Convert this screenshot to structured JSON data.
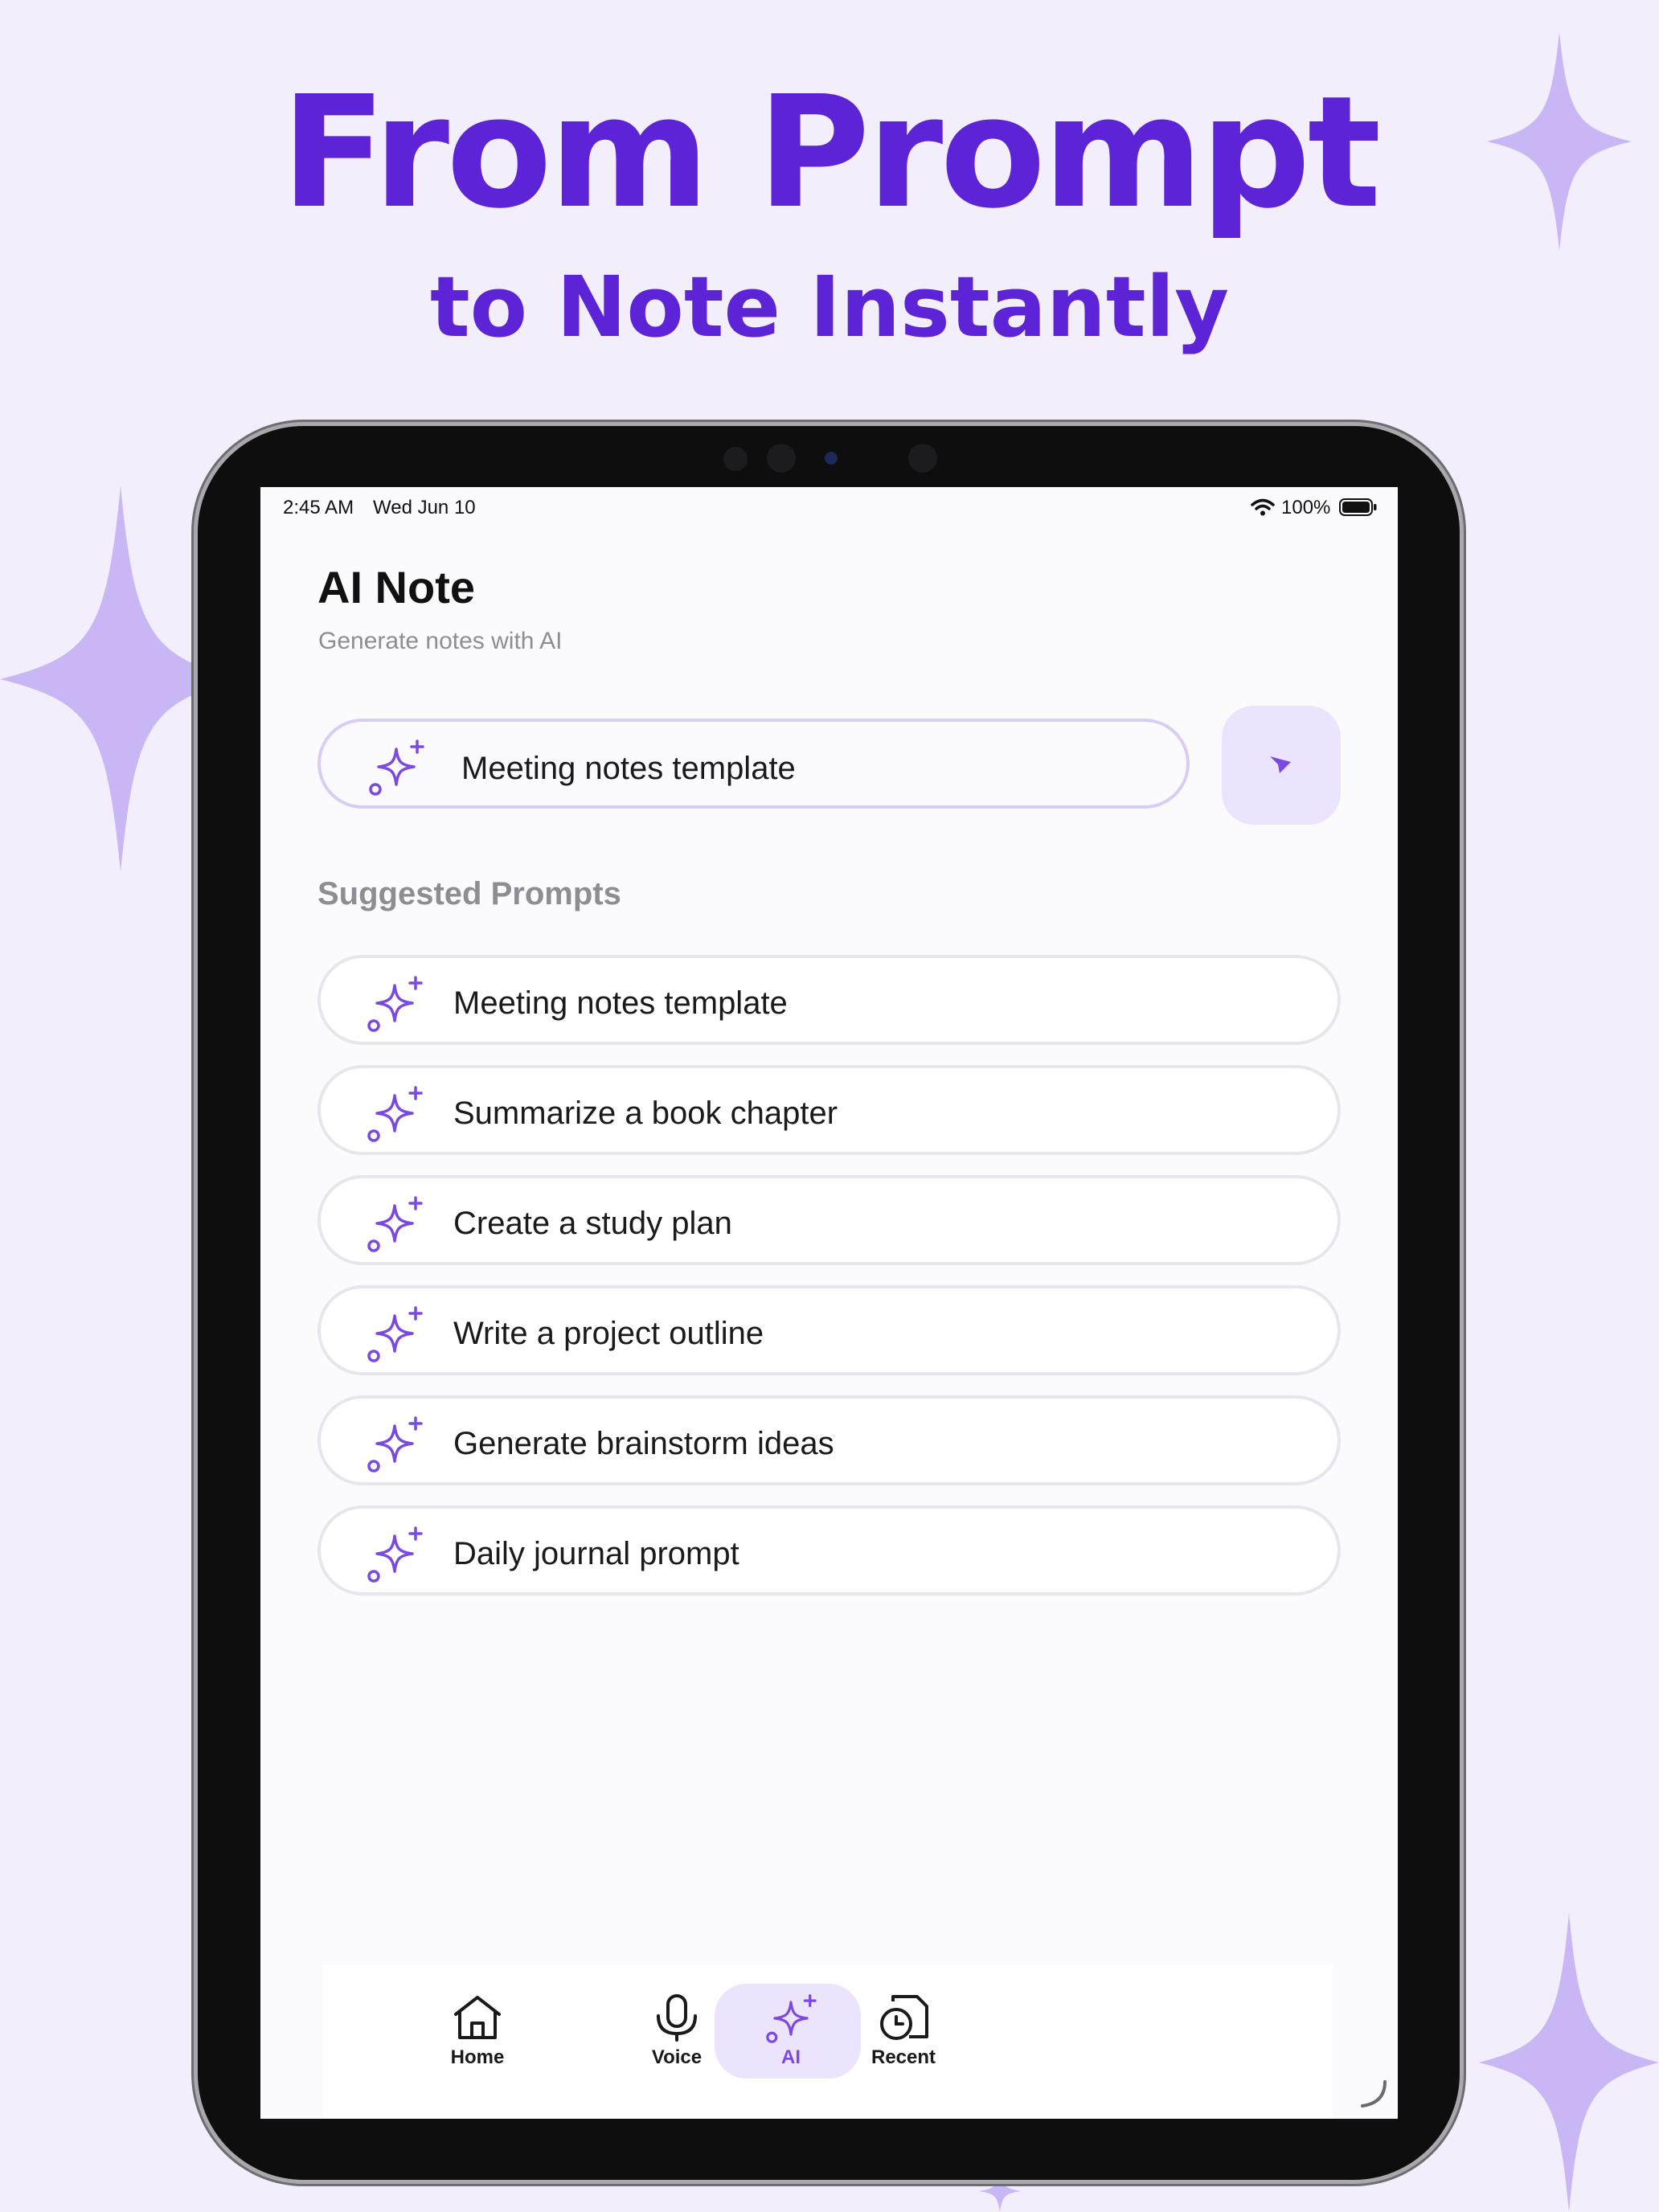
{
  "hero": {
    "title": "From Prompt",
    "subtitle": "to Note Instantly"
  },
  "colors": {
    "accent": "#5c24d6",
    "sparkle": "#c9b7f5",
    "icon_purple": "#7a4ae0",
    "tab_active_bg": "#ece4fc"
  },
  "status_bar": {
    "time": "2:45 AM",
    "date": "Wed Jun 10",
    "battery": "100%"
  },
  "app": {
    "title": "AI Note",
    "subtitle": "Generate notes with AI"
  },
  "prompt_input": {
    "value": "Meeting notes template",
    "icon": "sparkles-icon",
    "send_icon": "send-icon"
  },
  "suggested": {
    "title": "Suggested Prompts",
    "items": [
      {
        "label": "Meeting notes template"
      },
      {
        "label": "Summarize a book chapter"
      },
      {
        "label": "Create a study plan"
      },
      {
        "label": "Write a project outline"
      },
      {
        "label": "Generate brainstorm ideas"
      },
      {
        "label": "Daily journal prompt"
      }
    ]
  },
  "tabbar": {
    "active": "AI",
    "items": [
      {
        "label": "Home",
        "icon": "home-icon"
      },
      {
        "label": "Voice",
        "icon": "microphone-icon"
      },
      {
        "label": "AI",
        "icon": "sparkles-icon"
      },
      {
        "label": "Recent",
        "icon": "recent-icon"
      }
    ]
  }
}
